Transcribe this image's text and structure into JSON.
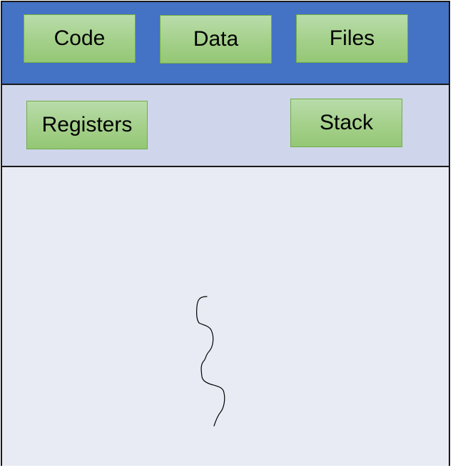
{
  "shared_row": {
    "code_label": "Code",
    "data_label": "Data",
    "files_label": "Files"
  },
  "thread_row": {
    "registers_label": "Registers",
    "stack_label": "Stack"
  },
  "colors": {
    "shared_band": "#4472c4",
    "thread_band": "#cfd5ea",
    "body_band": "#e8ebf4",
    "box_fill": "#a4d08a",
    "box_border": "#70ad47",
    "outline": "#1a1a1a"
  },
  "icons": {
    "thread": "wavy-thread-line"
  }
}
